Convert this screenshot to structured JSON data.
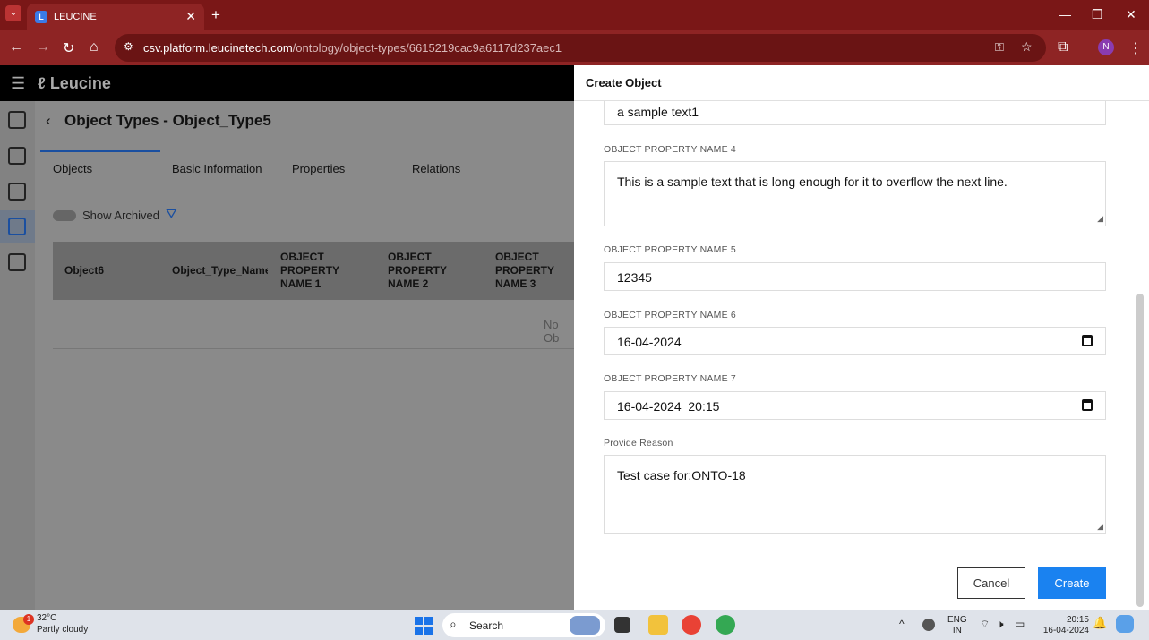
{
  "browser": {
    "tab_title": "LEUCINE",
    "tab_favicon": "L",
    "url_host": "csv.platform.leucinetech.com",
    "url_path": "/ontology/object-types/6615219cac9a6117d237aec1",
    "profile_initial": "N"
  },
  "app": {
    "brand": "Leucine",
    "page_title": "Object Types - Object_Type5",
    "tabs": [
      "Objects",
      "Basic Information",
      "Properties",
      "Relations"
    ],
    "show_archived_label": "Show Archived",
    "table_headers": [
      "Object6",
      "Object_Type_Name",
      "OBJECT PROPERTY NAME 1",
      "OBJECT PROPERTY NAME 2",
      "OBJECT PROPERTY NAME 3"
    ],
    "empty_text": "No Ob"
  },
  "drawer": {
    "title": "Create Object",
    "field3_value": "a sample text1",
    "field4_label": "OBJECT PROPERTY NAME 4",
    "field4_value": "This is a sample text that is long enough for it to overflow the next line.",
    "field5_label": "OBJECT PROPERTY NAME 5",
    "field5_value": "12345",
    "field6_label": "OBJECT PROPERTY NAME 6",
    "field6_value": "16-04-2024",
    "field7_label": "OBJECT PROPERTY NAME 7",
    "field7_value": "16-04-2024  20:15",
    "reason_label": "Provide Reason",
    "reason_value": "Test case for:ONTO-18",
    "cancel_label": "Cancel",
    "create_label": "Create",
    "accent": "#1a82f0"
  },
  "taskbar": {
    "temp": "32°C",
    "weather": "Partly cloudy",
    "weather_badge": "1",
    "search_label": "Search",
    "lang1": "ENG",
    "lang2": "IN",
    "time": "20:15",
    "date": "16-04-2024"
  }
}
